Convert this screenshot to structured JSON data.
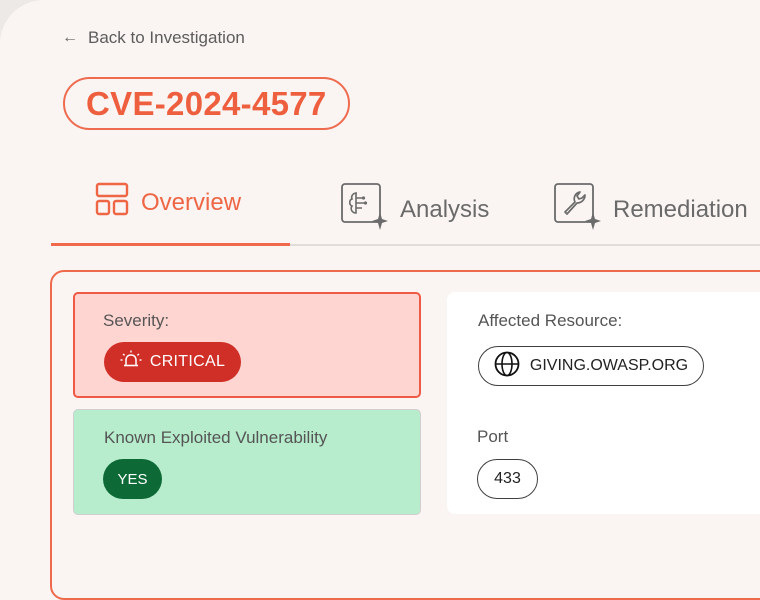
{
  "nav": {
    "back_label": "Back to Investigation",
    "back_icon": "arrow-left-icon"
  },
  "title": {
    "cve_id": "CVE-2024-4577"
  },
  "tabs": [
    {
      "label": "Overview",
      "icon": "layout-grid-icon",
      "active": true
    },
    {
      "label": "Analysis",
      "icon": "brain-sparkle-icon",
      "active": false
    },
    {
      "label": "Remediation",
      "icon": "wrench-sparkle-icon",
      "active": false
    }
  ],
  "severity": {
    "label": "Severity:",
    "value": "CRITICAL",
    "icon": "siren-icon",
    "color": "#cf2f27"
  },
  "kev": {
    "label": "Known Exploited Vulnerability",
    "value": "YES",
    "color": "#0d6a37"
  },
  "resource": {
    "label": "Affected Resource:",
    "value": "GIVING.OWASP.ORG",
    "icon": "globe-icon"
  },
  "port": {
    "label": "Port",
    "value": "433"
  },
  "colors": {
    "accent": "#ef6a4c",
    "critical_bg": "#ffd5d2",
    "kev_bg": "#b7edcd"
  }
}
